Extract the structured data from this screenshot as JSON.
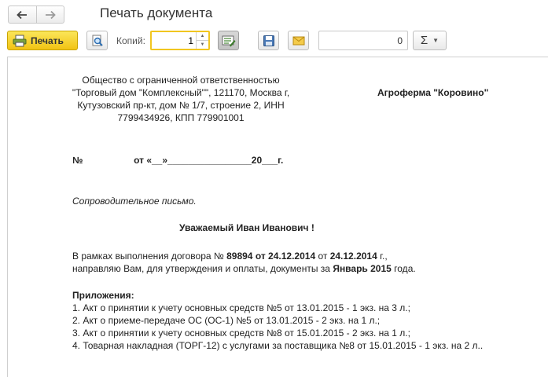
{
  "window": {
    "title": "Печать документа"
  },
  "toolbar": {
    "print_label": "Печать",
    "copies_label": "Копий:",
    "copies_value": "1",
    "sum_value": "0",
    "sum_symbol": "Σ"
  },
  "icons": {
    "back": "arrow-left-icon",
    "forward": "arrow-right-icon",
    "print": "printer-icon",
    "preview": "print-preview-icon",
    "edit": "edit-document-icon",
    "save": "floppy-disk-icon",
    "mail": "envelope-icon",
    "sum_dropdown": "chevron-down-icon"
  },
  "colors": {
    "print_button": "#f6d32d",
    "copies_focus_border": "#f1c620",
    "mail_icon": "#e7b92c"
  },
  "document": {
    "sender": [
      "Общество с ограниченной ответственностью",
      "\"Торговый дом \"Комплексный\"\", 121170, Москва г,",
      "Кутузовский пр-кт, дом № 1/7, строение 2, ИНН",
      "7799434926, КПП 779901001"
    ],
    "recipient": "Агроферма \"Коровино\"",
    "number_label": "№",
    "date_line": "от «__»________________20___г.",
    "cover_letter": "Сопроводительное письмо.",
    "greeting": "Уважаемый Иван Иванович  !",
    "body": {
      "part1": "В рамках выполнения договора № ",
      "contract_no": "89894",
      "part2": " от 24.12.2014",
      "part3": " от ",
      "contract_date": "24.12.2014",
      "part4": " г.,",
      "line2_start": "направляю Вам, для утверждения и оплаты, документы за ",
      "period": "Январь 2015",
      "line2_end": " года."
    },
    "attachments_title": "Приложения:",
    "attachments": [
      "1. Акт о принятии к учету основных средств №5 от 13.01.2015 - 1 экз. на 3 л.;",
      "2. Акт о приеме-передаче ОС (ОС-1) №5 от 13.01.2015 - 2 экз. на 1 л.;",
      "3. Акт о принятии к учету основных средств №8 от 15.01.2015 - 2 экз. на 1 л.;",
      "4. Товарная накладная (ТОРГ-12) с услугами за поставщика №8 от 15.01.2015 - 1 экз. на 2 л.."
    ]
  }
}
